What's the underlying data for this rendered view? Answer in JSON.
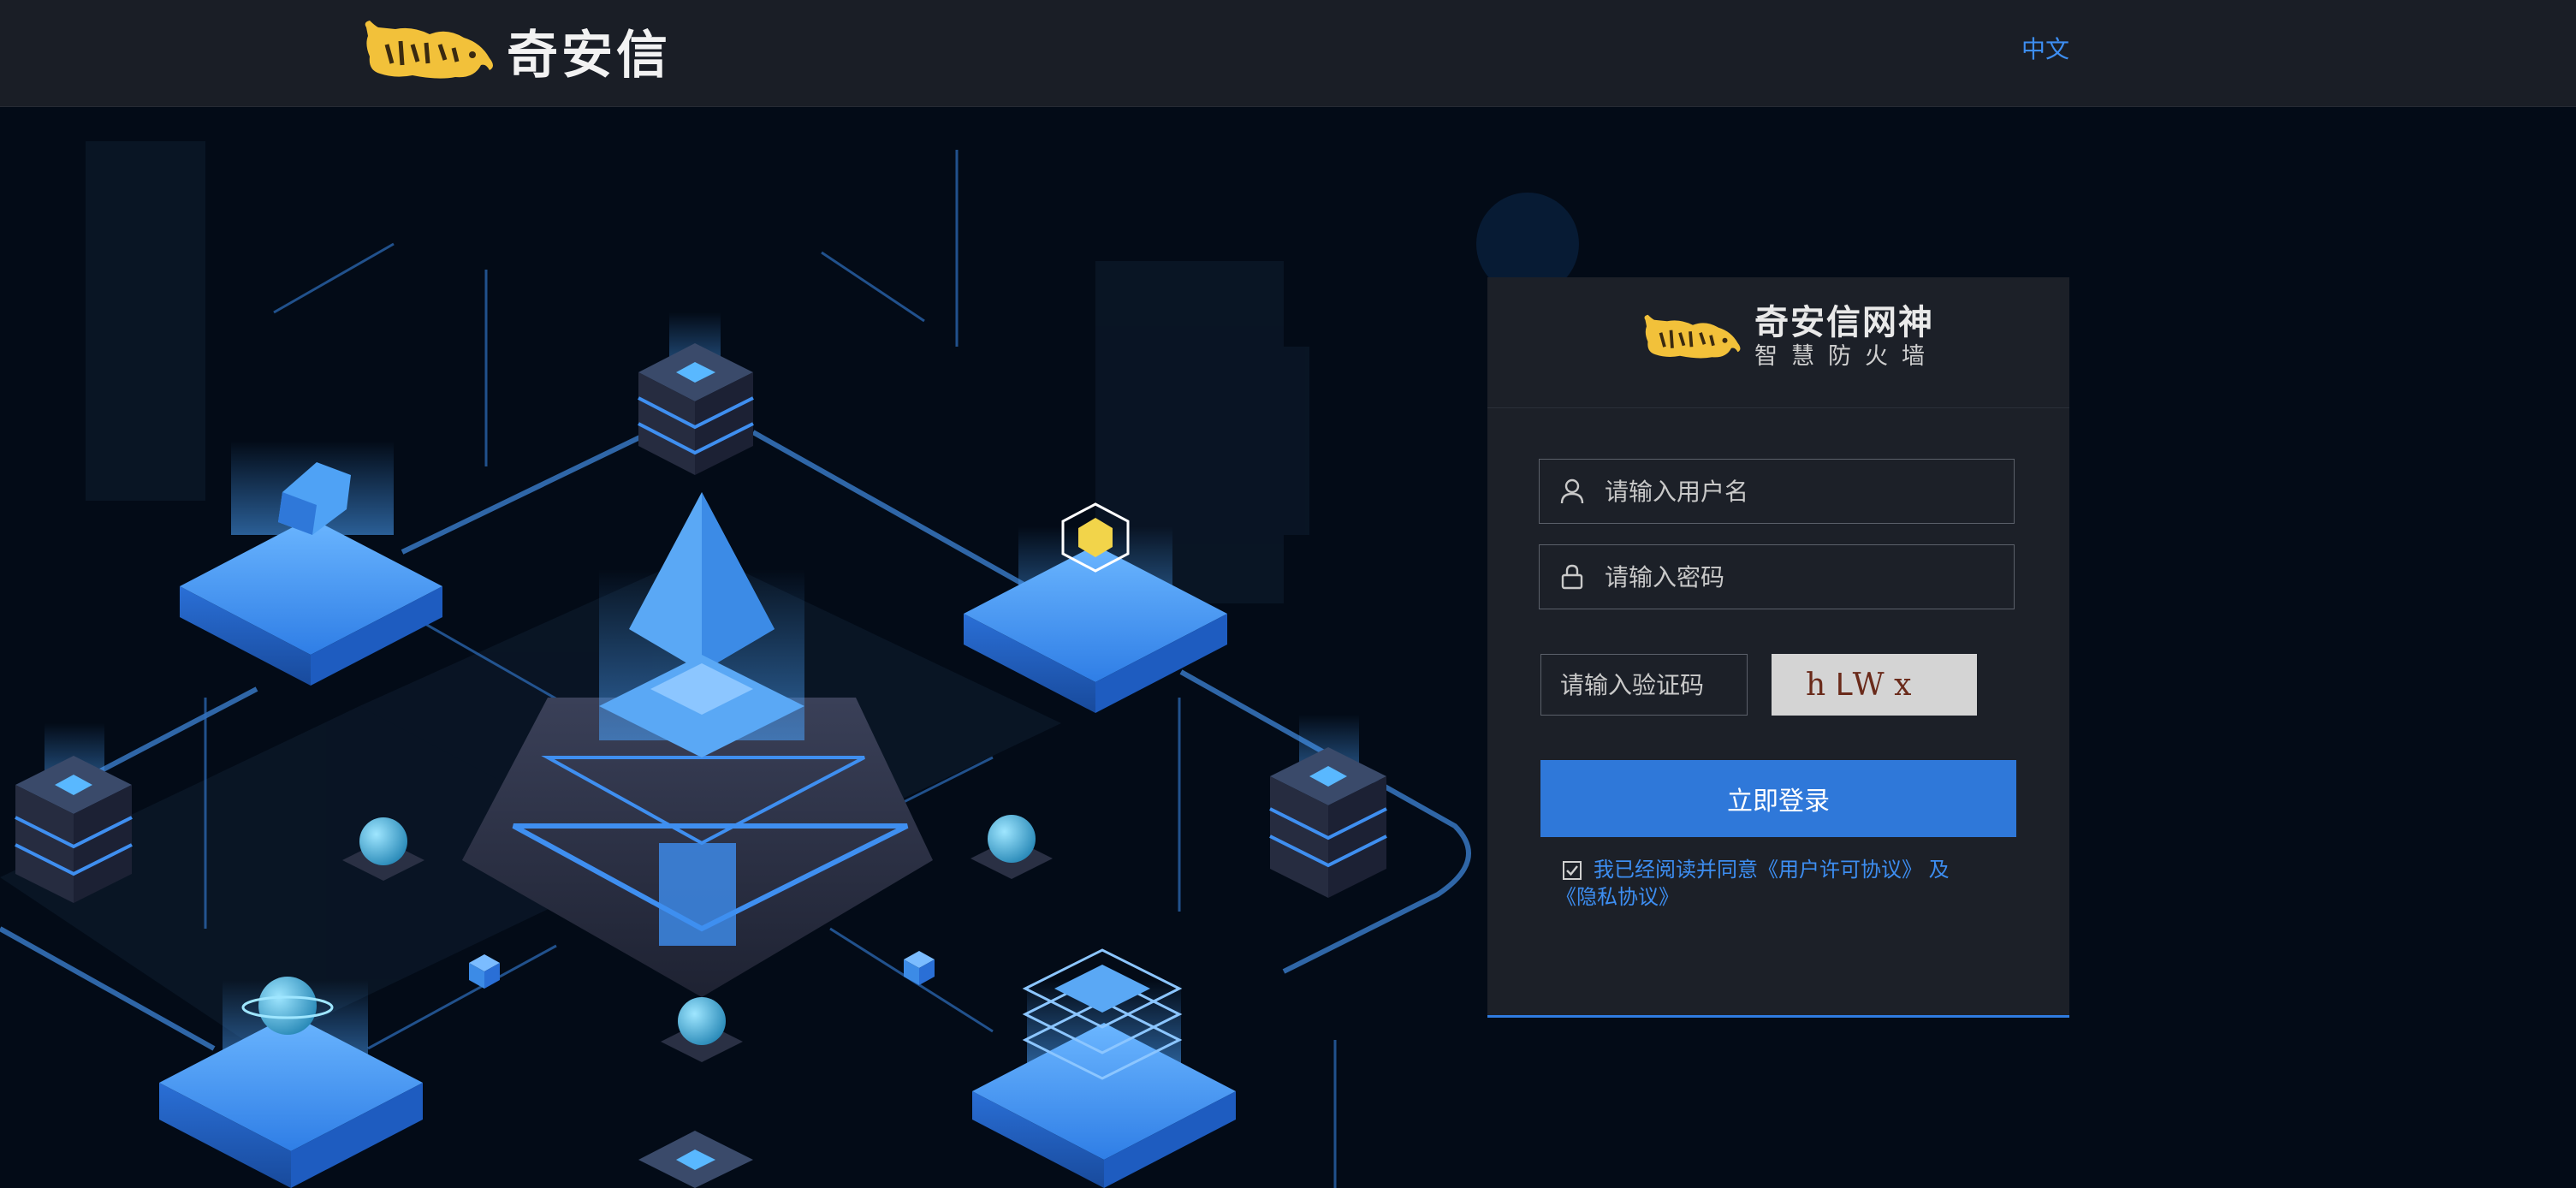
{
  "header": {
    "brand_name": "奇安信",
    "language": "中文"
  },
  "login": {
    "product_name": "奇安信网神",
    "product_sub": "智慧防火墙",
    "username_placeholder": "请输入用户名",
    "password_placeholder": "请输入密码",
    "captcha_placeholder": "请输入验证码",
    "captcha_text": "h ᒪW x",
    "submit_label": "立即登录",
    "agree_prefix": "我已经阅读并同意",
    "agree_license": "《用户许可协议》",
    "agree_and": " 及",
    "agree_privacy": "《隐私协议》"
  },
  "colors": {
    "accent": "#2f78d9",
    "link": "#3d8ef2",
    "panel": "#1c2028",
    "header": "#1a1e26",
    "background": "#030b17",
    "logo_yellow": "#f2c13a"
  },
  "icons": [
    "tiger-logo",
    "user-icon",
    "lock-icon",
    "checkbox-checked-icon"
  ]
}
